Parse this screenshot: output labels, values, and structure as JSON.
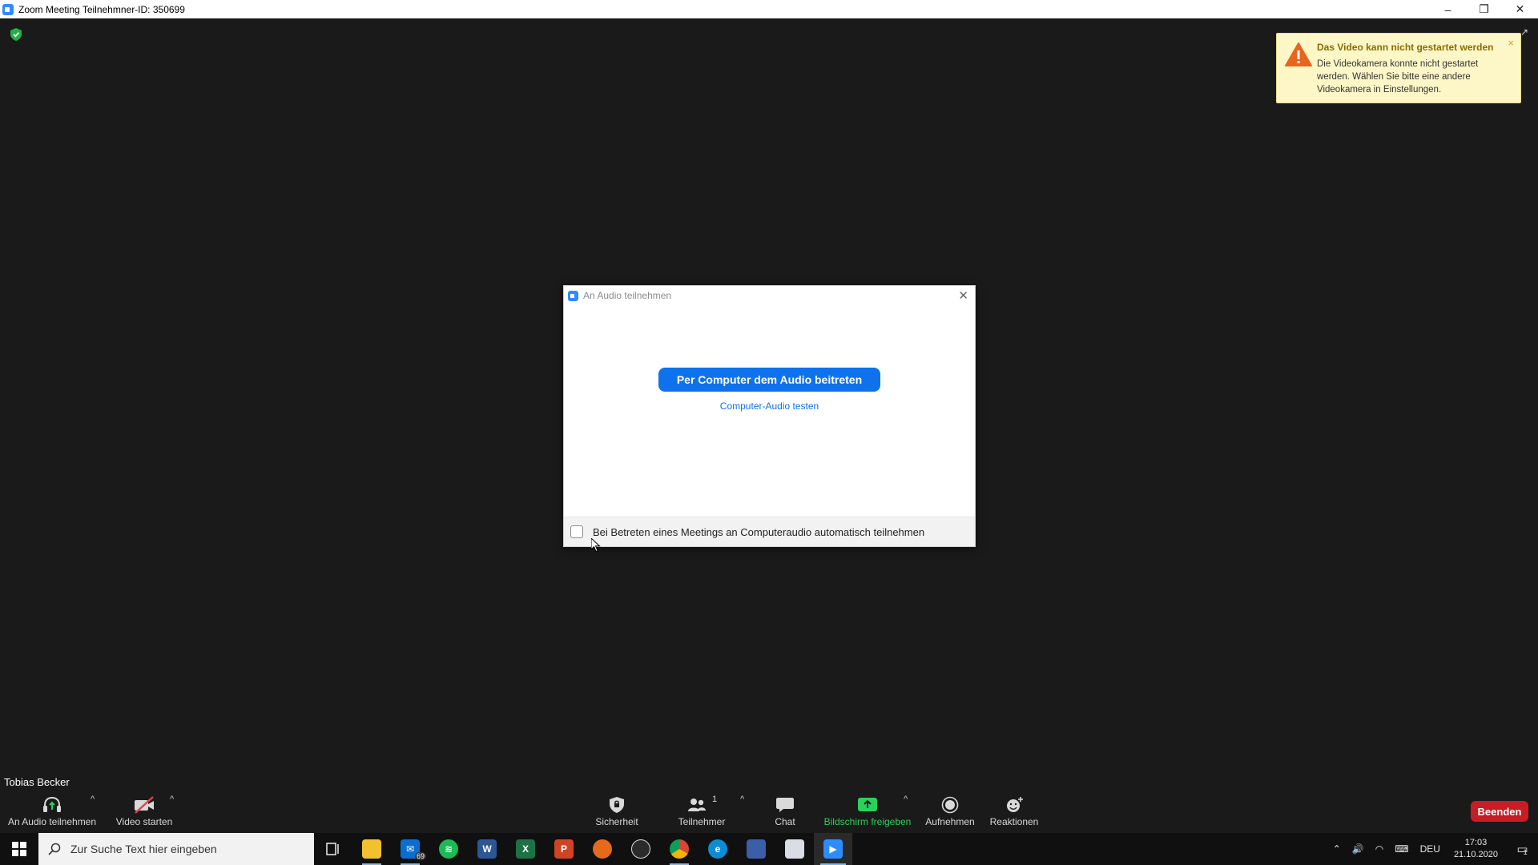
{
  "window": {
    "title": "Zoom Meeting Teilnehmner-ID: 350699",
    "controls": {
      "minimize": "–",
      "restore": "❐",
      "close": "✕"
    }
  },
  "notification": {
    "title": "Das Video kann nicht gestartet werden",
    "body": "Die Videokamera konnte nicht gestartet werden. Wählen Sie bitte eine andere Videokamera in Einstellungen.",
    "close": "×"
  },
  "dialog": {
    "title": "An Audio teilnehmen",
    "close": "✕",
    "join_button": "Per Computer dem Audio beitreten",
    "test_link": "Computer-Audio testen",
    "auto_join_label": "Bei Betreten eines Meetings an Computeraudio automatisch teilnehmen",
    "auto_join_checked": false
  },
  "participant": {
    "name": "Tobias Becker"
  },
  "toolbar": {
    "audio": "An Audio teilnehmen",
    "video": "Video starten",
    "security": "Sicherheit",
    "participants": "Teilnehmer",
    "participants_count": "1",
    "chat": "Chat",
    "share": "Bildschirm freigeben",
    "record": "Aufnehmen",
    "reactions": "Reaktionen",
    "end": "Beenden",
    "caret": "^"
  },
  "taskbar": {
    "search_placeholder": "Zur Suche Text hier eingeben",
    "mail_badge": "69",
    "language": "DEU",
    "time": "17:03",
    "date": "21.10.2020",
    "notification_count": "1"
  },
  "colors": {
    "zoom_blue": "#0e72ed",
    "end_red": "#c81d25",
    "share_green": "#2ad25d",
    "warning_bg": "#fdf7c7"
  }
}
